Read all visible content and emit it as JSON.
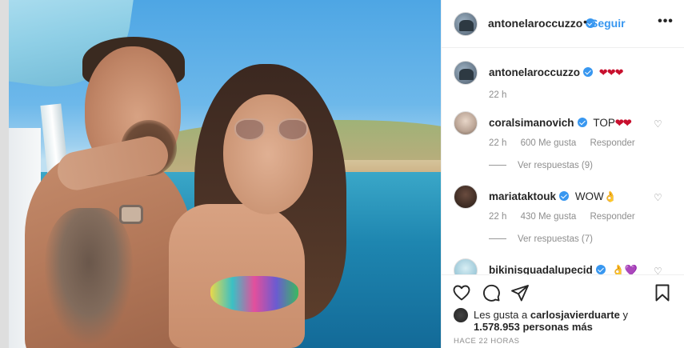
{
  "header": {
    "username": "antonelaroccuzzo",
    "follow_dot": "•",
    "follow_label": "Seguir",
    "options_label": "•••"
  },
  "caption": {
    "username": "antonelaroccuzzo",
    "text": "❤❤❤",
    "time": "22 h"
  },
  "comments": [
    {
      "username": "coralsimanovich",
      "text": "TOP",
      "emoji": "❤❤",
      "time": "22 h",
      "likes": "600 Me gusta",
      "reply_label": "Responder",
      "replies": "Ver respuestas (9)"
    },
    {
      "username": "mariataktouk",
      "text": "WOW",
      "emoji": "👌",
      "time": "22 h",
      "likes": "430 Me gusta",
      "reply_label": "Responder",
      "replies": "Ver respuestas (7)"
    },
    {
      "username": "bikinisguadalupecid",
      "text": "",
      "emoji": "👌💜"
    }
  ],
  "likes": {
    "prefix": "Les gusta a",
    "user": "carlosjavierduarte",
    "suffix": "y",
    "count": "1.578.953 personas más"
  },
  "timestamp": "HACE 22 HORAS",
  "icons": {
    "heart": "heart-icon",
    "comment": "comment-icon",
    "share": "share-icon",
    "save": "bookmark-icon",
    "options": "more-options-icon"
  },
  "colors": {
    "link_blue": "#3897f0",
    "text": "#262626",
    "muted": "#8e8e8e"
  }
}
